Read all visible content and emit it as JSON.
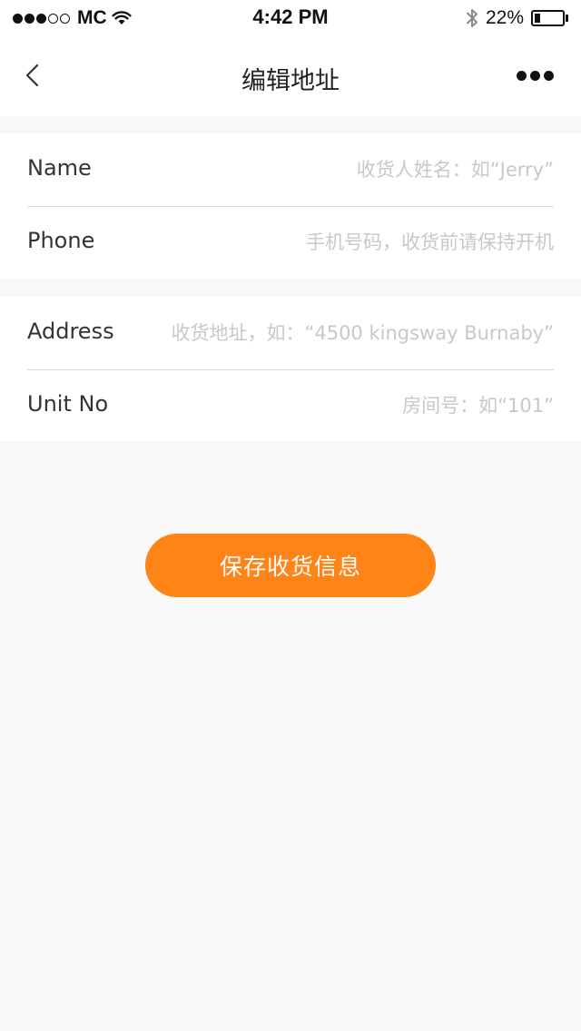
{
  "status_bar": {
    "carrier": "MC",
    "time": "4:42 PM",
    "battery_percent": "22%",
    "battery_level": 0.22,
    "signal_dots_filled": 3,
    "signal_dots_total": 5
  },
  "nav": {
    "title": "编辑地址",
    "back_icon": "chevron-left-icon",
    "more_icon": "more-horizontal-icon"
  },
  "form": {
    "name": {
      "label": "Name",
      "placeholder": "收货人姓名：如“Jerry”"
    },
    "phone": {
      "label": "Phone",
      "placeholder": "手机号码，收货前请保持开机"
    },
    "address": {
      "label": "Address",
      "placeholder": "收货地址，如：“4500 kingsway Burnaby”"
    },
    "unit": {
      "label": "Unit No",
      "placeholder": "房间号：如“101”"
    }
  },
  "save_button": {
    "label": "保存收货信息",
    "color": "#ff8417"
  },
  "colors": {
    "background": "#f8f8f8",
    "surface": "#ffffff",
    "placeholder": "#c8c8c8",
    "divider": "#d9d9d9"
  }
}
